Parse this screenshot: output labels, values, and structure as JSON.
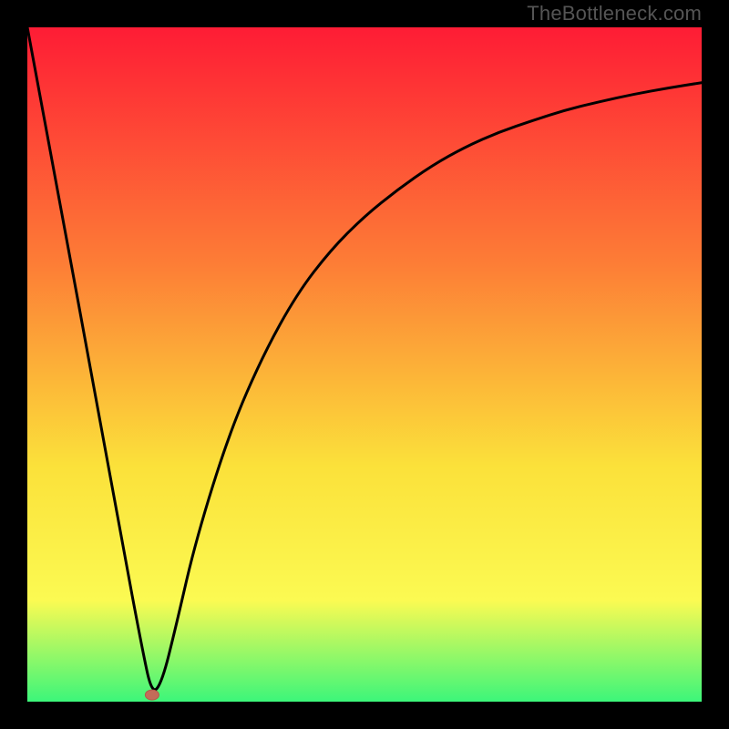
{
  "watermark": "TheBottleneck.com",
  "colors": {
    "page_bg": "#000000",
    "gradient_top": "#fe1c35",
    "gradient_mid1": "#fd7d36",
    "gradient_mid2": "#fbe13a",
    "gradient_mid3": "#fbfa52",
    "gradient_bottom": "#3cf67a",
    "curve_stroke": "#000000",
    "marker_fill": "#c36b59",
    "marker_stroke": "#b2594a"
  },
  "chart_data": {
    "type": "line",
    "title": "",
    "xlabel": "",
    "ylabel": "",
    "xlim": [
      0,
      100
    ],
    "ylim": [
      0,
      100
    ],
    "series": [
      {
        "name": "bottleneck-curve",
        "x": [
          0,
          5,
          10,
          14,
          17,
          18.5,
          20,
          22,
          25,
          30,
          35,
          40,
          45,
          50,
          55,
          60,
          65,
          70,
          75,
          80,
          85,
          90,
          95,
          100
        ],
        "values": [
          100,
          73,
          46,
          24,
          8,
          1,
          3,
          11,
          24,
          40,
          51.5,
          60.5,
          67,
          72,
          76,
          79.5,
          82.3,
          84.5,
          86.2,
          87.8,
          89,
          90.1,
          91,
          91.8
        ]
      }
    ],
    "marker": {
      "x": 18.5,
      "y": 1
    }
  }
}
